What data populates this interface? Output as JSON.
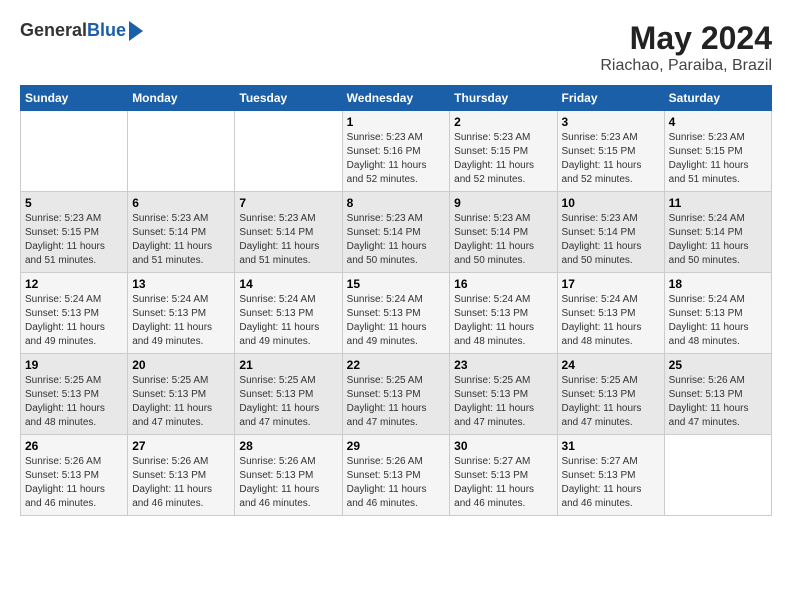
{
  "header": {
    "logo_general": "General",
    "logo_blue": "Blue",
    "month_year": "May 2024",
    "location": "Riachao, Paraiba, Brazil"
  },
  "days_of_week": [
    "Sunday",
    "Monday",
    "Tuesday",
    "Wednesday",
    "Thursday",
    "Friday",
    "Saturday"
  ],
  "weeks": [
    [
      {
        "day": "",
        "info": ""
      },
      {
        "day": "",
        "info": ""
      },
      {
        "day": "",
        "info": ""
      },
      {
        "day": "1",
        "info": "Sunrise: 5:23 AM\nSunset: 5:16 PM\nDaylight: 11 hours and 52 minutes."
      },
      {
        "day": "2",
        "info": "Sunrise: 5:23 AM\nSunset: 5:15 PM\nDaylight: 11 hours and 52 minutes."
      },
      {
        "day": "3",
        "info": "Sunrise: 5:23 AM\nSunset: 5:15 PM\nDaylight: 11 hours and 52 minutes."
      },
      {
        "day": "4",
        "info": "Sunrise: 5:23 AM\nSunset: 5:15 PM\nDaylight: 11 hours and 51 minutes."
      }
    ],
    [
      {
        "day": "5",
        "info": "Sunrise: 5:23 AM\nSunset: 5:15 PM\nDaylight: 11 hours and 51 minutes."
      },
      {
        "day": "6",
        "info": "Sunrise: 5:23 AM\nSunset: 5:14 PM\nDaylight: 11 hours and 51 minutes."
      },
      {
        "day": "7",
        "info": "Sunrise: 5:23 AM\nSunset: 5:14 PM\nDaylight: 11 hours and 51 minutes."
      },
      {
        "day": "8",
        "info": "Sunrise: 5:23 AM\nSunset: 5:14 PM\nDaylight: 11 hours and 50 minutes."
      },
      {
        "day": "9",
        "info": "Sunrise: 5:23 AM\nSunset: 5:14 PM\nDaylight: 11 hours and 50 minutes."
      },
      {
        "day": "10",
        "info": "Sunrise: 5:23 AM\nSunset: 5:14 PM\nDaylight: 11 hours and 50 minutes."
      },
      {
        "day": "11",
        "info": "Sunrise: 5:24 AM\nSunset: 5:14 PM\nDaylight: 11 hours and 50 minutes."
      }
    ],
    [
      {
        "day": "12",
        "info": "Sunrise: 5:24 AM\nSunset: 5:13 PM\nDaylight: 11 hours and 49 minutes."
      },
      {
        "day": "13",
        "info": "Sunrise: 5:24 AM\nSunset: 5:13 PM\nDaylight: 11 hours and 49 minutes."
      },
      {
        "day": "14",
        "info": "Sunrise: 5:24 AM\nSunset: 5:13 PM\nDaylight: 11 hours and 49 minutes."
      },
      {
        "day": "15",
        "info": "Sunrise: 5:24 AM\nSunset: 5:13 PM\nDaylight: 11 hours and 49 minutes."
      },
      {
        "day": "16",
        "info": "Sunrise: 5:24 AM\nSunset: 5:13 PM\nDaylight: 11 hours and 48 minutes."
      },
      {
        "day": "17",
        "info": "Sunrise: 5:24 AM\nSunset: 5:13 PM\nDaylight: 11 hours and 48 minutes."
      },
      {
        "day": "18",
        "info": "Sunrise: 5:24 AM\nSunset: 5:13 PM\nDaylight: 11 hours and 48 minutes."
      }
    ],
    [
      {
        "day": "19",
        "info": "Sunrise: 5:25 AM\nSunset: 5:13 PM\nDaylight: 11 hours and 48 minutes."
      },
      {
        "day": "20",
        "info": "Sunrise: 5:25 AM\nSunset: 5:13 PM\nDaylight: 11 hours and 47 minutes."
      },
      {
        "day": "21",
        "info": "Sunrise: 5:25 AM\nSunset: 5:13 PM\nDaylight: 11 hours and 47 minutes."
      },
      {
        "day": "22",
        "info": "Sunrise: 5:25 AM\nSunset: 5:13 PM\nDaylight: 11 hours and 47 minutes."
      },
      {
        "day": "23",
        "info": "Sunrise: 5:25 AM\nSunset: 5:13 PM\nDaylight: 11 hours and 47 minutes."
      },
      {
        "day": "24",
        "info": "Sunrise: 5:25 AM\nSunset: 5:13 PM\nDaylight: 11 hours and 47 minutes."
      },
      {
        "day": "25",
        "info": "Sunrise: 5:26 AM\nSunset: 5:13 PM\nDaylight: 11 hours and 47 minutes."
      }
    ],
    [
      {
        "day": "26",
        "info": "Sunrise: 5:26 AM\nSunset: 5:13 PM\nDaylight: 11 hours and 46 minutes."
      },
      {
        "day": "27",
        "info": "Sunrise: 5:26 AM\nSunset: 5:13 PM\nDaylight: 11 hours and 46 minutes."
      },
      {
        "day": "28",
        "info": "Sunrise: 5:26 AM\nSunset: 5:13 PM\nDaylight: 11 hours and 46 minutes."
      },
      {
        "day": "29",
        "info": "Sunrise: 5:26 AM\nSunset: 5:13 PM\nDaylight: 11 hours and 46 minutes."
      },
      {
        "day": "30",
        "info": "Sunrise: 5:27 AM\nSunset: 5:13 PM\nDaylight: 11 hours and 46 minutes."
      },
      {
        "day": "31",
        "info": "Sunrise: 5:27 AM\nSunset: 5:13 PM\nDaylight: 11 hours and 46 minutes."
      },
      {
        "day": "",
        "info": ""
      }
    ]
  ]
}
